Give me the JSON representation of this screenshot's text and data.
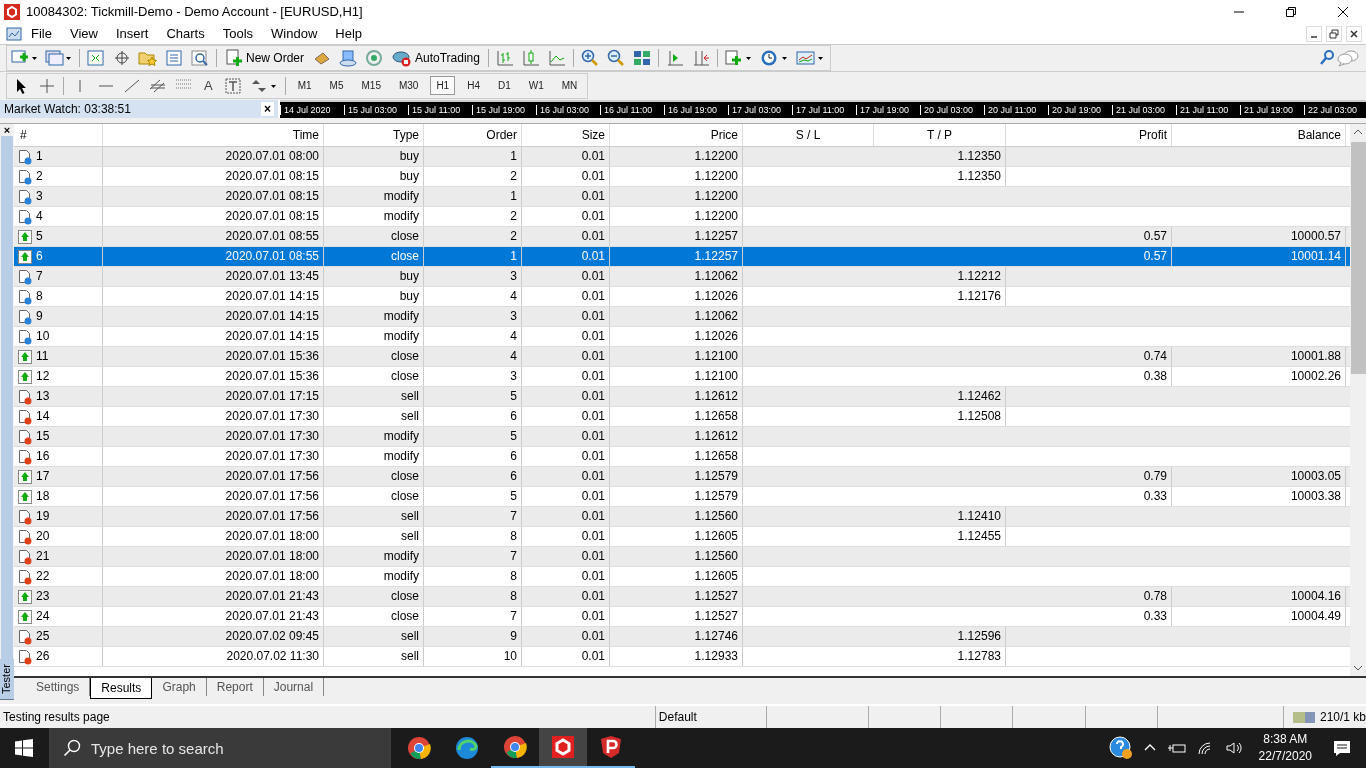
{
  "window": {
    "title": "10084302: Tickmill-Demo - Demo Account - [EURUSD,H1]"
  },
  "menu": [
    "File",
    "View",
    "Insert",
    "Charts",
    "Tools",
    "Window",
    "Help"
  ],
  "toolbar": {
    "new_order": "New Order",
    "auto_trading": "AutoTrading"
  },
  "drawing_tools": {
    "text_tool": "A"
  },
  "timeframes": [
    {
      "label": "M1",
      "selected": false
    },
    {
      "label": "M5",
      "selected": false
    },
    {
      "label": "M15",
      "selected": false
    },
    {
      "label": "M30",
      "selected": false
    },
    {
      "label": "H1",
      "selected": true
    },
    {
      "label": "H4",
      "selected": false
    },
    {
      "label": "D1",
      "selected": false
    },
    {
      "label": "W1",
      "selected": false
    },
    {
      "label": "MN",
      "selected": false
    }
  ],
  "market_watch": {
    "title": "Market Watch: 03:38:51",
    "close": "×"
  },
  "timeline": [
    "14 Jul 2020",
    "15 Jul 03:00",
    "15 Jul 11:00",
    "15 Jul 19:00",
    "16 Jul 03:00",
    "16 Jul 11:00",
    "16 Jul 19:00",
    "17 Jul 03:00",
    "17 Jul 11:00",
    "17 Jul 19:00",
    "20 Jul 03:00",
    "20 Jul 11:00",
    "20 Jul 19:00",
    "21 Jul 03:00",
    "21 Jul 11:00",
    "21 Jul 19:00",
    "22 Jul 03:00"
  ],
  "tester": {
    "label": "Tester",
    "close": "×"
  },
  "table": {
    "columns": [
      "#",
      "Time",
      "Type",
      "Order",
      "Size",
      "Price",
      "S / L",
      "T / P",
      "Profit",
      "Balance"
    ],
    "rows": [
      {
        "kind": "buy",
        "selected": false,
        "n": "1",
        "time": "2020.07.01 08:00",
        "type": "buy",
        "order": "1",
        "size": "0.01",
        "price": "1.12200",
        "tp": "1.12350"
      },
      {
        "kind": "buy",
        "selected": false,
        "n": "2",
        "time": "2020.07.01 08:15",
        "type": "buy",
        "order": "2",
        "size": "0.01",
        "price": "1.12200",
        "tp": "1.12350"
      },
      {
        "kind": "buy",
        "selected": false,
        "n": "3",
        "time": "2020.07.01 08:15",
        "type": "modify",
        "order": "1",
        "size": "0.01",
        "price": "1.12200"
      },
      {
        "kind": "buy",
        "selected": false,
        "n": "4",
        "time": "2020.07.01 08:15",
        "type": "modify",
        "order": "2",
        "size": "0.01",
        "price": "1.12200"
      },
      {
        "kind": "close",
        "selected": false,
        "n": "5",
        "time": "2020.07.01 08:55",
        "type": "close",
        "order": "2",
        "size": "0.01",
        "price": "1.12257",
        "profit": "0.57",
        "balance": "10000.57"
      },
      {
        "kind": "close",
        "selected": true,
        "n": "6",
        "time": "2020.07.01 08:55",
        "type": "close",
        "order": "1",
        "size": "0.01",
        "price": "1.12257",
        "profit": "0.57",
        "balance": "10001.14"
      },
      {
        "kind": "buy",
        "selected": false,
        "n": "7",
        "time": "2020.07.01 13:45",
        "type": "buy",
        "order": "3",
        "size": "0.01",
        "price": "1.12062",
        "tp": "1.12212"
      },
      {
        "kind": "buy",
        "selected": false,
        "n": "8",
        "time": "2020.07.01 14:15",
        "type": "buy",
        "order": "4",
        "size": "0.01",
        "price": "1.12026",
        "tp": "1.12176"
      },
      {
        "kind": "buy",
        "selected": false,
        "n": "9",
        "time": "2020.07.01 14:15",
        "type": "modify",
        "order": "3",
        "size": "0.01",
        "price": "1.12062"
      },
      {
        "kind": "buy",
        "selected": false,
        "n": "10",
        "time": "2020.07.01 14:15",
        "type": "modify",
        "order": "4",
        "size": "0.01",
        "price": "1.12026"
      },
      {
        "kind": "close",
        "selected": false,
        "n": "11",
        "time": "2020.07.01 15:36",
        "type": "close",
        "order": "4",
        "size": "0.01",
        "price": "1.12100",
        "profit": "0.74",
        "balance": "10001.88"
      },
      {
        "kind": "close",
        "selected": false,
        "n": "12",
        "time": "2020.07.01 15:36",
        "type": "close",
        "order": "3",
        "size": "0.01",
        "price": "1.12100",
        "profit": "0.38",
        "balance": "10002.26"
      },
      {
        "kind": "sell",
        "selected": false,
        "n": "13",
        "time": "2020.07.01 17:15",
        "type": "sell",
        "order": "5",
        "size": "0.01",
        "price": "1.12612",
        "tp": "1.12462"
      },
      {
        "kind": "sell",
        "selected": false,
        "n": "14",
        "time": "2020.07.01 17:30",
        "type": "sell",
        "order": "6",
        "size": "0.01",
        "price": "1.12658",
        "tp": "1.12508"
      },
      {
        "kind": "sell",
        "selected": false,
        "n": "15",
        "time": "2020.07.01 17:30",
        "type": "modify",
        "order": "5",
        "size": "0.01",
        "price": "1.12612"
      },
      {
        "kind": "sell",
        "selected": false,
        "n": "16",
        "time": "2020.07.01 17:30",
        "type": "modify",
        "order": "6",
        "size": "0.01",
        "price": "1.12658"
      },
      {
        "kind": "close",
        "selected": false,
        "n": "17",
        "time": "2020.07.01 17:56",
        "type": "close",
        "order": "6",
        "size": "0.01",
        "price": "1.12579",
        "profit": "0.79",
        "balance": "10003.05"
      },
      {
        "kind": "close",
        "selected": false,
        "n": "18",
        "time": "2020.07.01 17:56",
        "type": "close",
        "order": "5",
        "size": "0.01",
        "price": "1.12579",
        "profit": "0.33",
        "balance": "10003.38"
      },
      {
        "kind": "sell",
        "selected": false,
        "n": "19",
        "time": "2020.07.01 17:56",
        "type": "sell",
        "order": "7",
        "size": "0.01",
        "price": "1.12560",
        "tp": "1.12410"
      },
      {
        "kind": "sell",
        "selected": false,
        "n": "20",
        "time": "2020.07.01 18:00",
        "type": "sell",
        "order": "8",
        "size": "0.01",
        "price": "1.12605",
        "tp": "1.12455"
      },
      {
        "kind": "sell",
        "selected": false,
        "n": "21",
        "time": "2020.07.01 18:00",
        "type": "modify",
        "order": "7",
        "size": "0.01",
        "price": "1.12560"
      },
      {
        "kind": "sell",
        "selected": false,
        "n": "22",
        "time": "2020.07.01 18:00",
        "type": "modify",
        "order": "8",
        "size": "0.01",
        "price": "1.12605"
      },
      {
        "kind": "close",
        "selected": false,
        "n": "23",
        "time": "2020.07.01 21:43",
        "type": "close",
        "order": "8",
        "size": "0.01",
        "price": "1.12527",
        "profit": "0.78",
        "balance": "10004.16"
      },
      {
        "kind": "close",
        "selected": false,
        "n": "24",
        "time": "2020.07.01 21:43",
        "type": "close",
        "order": "7",
        "size": "0.01",
        "price": "1.12527",
        "profit": "0.33",
        "balance": "10004.49"
      },
      {
        "kind": "sell",
        "selected": false,
        "n": "25",
        "time": "2020.07.02 09:45",
        "type": "sell",
        "order": "9",
        "size": "0.01",
        "price": "1.12746",
        "tp": "1.12596"
      },
      {
        "kind": "sell",
        "selected": false,
        "n": "26",
        "time": "2020.07.02 11:30",
        "type": "sell",
        "order": "10",
        "size": "0.01",
        "price": "1.12933",
        "tp": "1.12783"
      }
    ]
  },
  "tabs": [
    {
      "label": "Settings",
      "selected": false
    },
    {
      "label": "Results",
      "selected": true
    },
    {
      "label": "Graph",
      "selected": false
    },
    {
      "label": "Report",
      "selected": false
    },
    {
      "label": "Journal",
      "selected": false
    }
  ],
  "status_bar": {
    "message": "Testing results page",
    "profile": "Default",
    "traffic": "210/1 kb"
  },
  "taskbar": {
    "search_placeholder": "Type here to search",
    "time": "8:38 AM",
    "date": "22/7/2020"
  }
}
